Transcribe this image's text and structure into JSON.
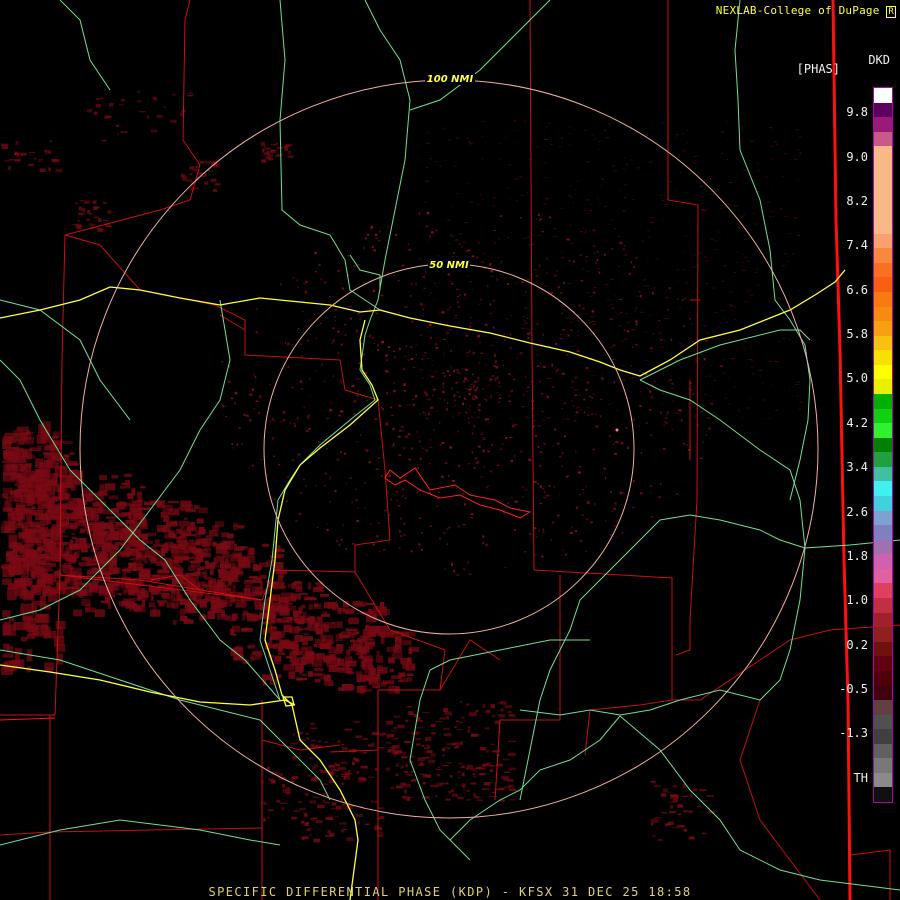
{
  "credit": "NEXLAB-College of DuPage",
  "credit_logo": "R",
  "product_code": "DKD",
  "units_label": "[PHAS]",
  "footer": "SPECIFIC DIFFERENTIAL PHASE (KDP) - KFSX 31 DEC 25 18:58",
  "range_rings": [
    {
      "label": "100 NMI"
    },
    {
      "label": "50 NMI"
    }
  ],
  "color_scale": {
    "ticks": [
      "9.8",
      "9.0",
      "8.2",
      "7.4",
      "6.6",
      "5.8",
      "5.0",
      "4.2",
      "3.4",
      "2.6",
      "1.8",
      "1.0",
      "0.2",
      "-0.5",
      "-1.3",
      "TH"
    ],
    "colors": [
      "#ffffff",
      "#5e0060",
      "#9a1a7a",
      "#c85a8a",
      "#f8b887",
      "#f8b887",
      "#f8b887",
      "#f8b887",
      "#f8b887",
      "#f8b887",
      "#f8a070",
      "#f88840",
      "#f87020",
      "#f86010",
      "#f87a10",
      "#f88a10",
      "#f8a010",
      "#f8c010",
      "#f8e000",
      "#ffff00",
      "#e8f000",
      "#00b000",
      "#10d010",
      "#30f030",
      "#008000",
      "#20a040",
      "#40c0a0",
      "#40f0f0",
      "#40d0e0",
      "#80a0d0",
      "#8080c0",
      "#a070b0",
      "#d060b0",
      "#e060a0",
      "#e04060",
      "#c03040",
      "#a02030",
      "#902020",
      "#701010",
      "#600010",
      "#500008",
      "#400010",
      "#604040",
      "#505050",
      "#404040",
      "#606060",
      "#787878",
      "#8a8a8a",
      "#101010"
    ]
  },
  "map_colors": {
    "county_lines": "#c81010",
    "state_line": "#ff1010",
    "highways": "#ffff40",
    "rivers": "#70e090",
    "rings": "#f0b0a0",
    "echo": "#7a0a14"
  }
}
